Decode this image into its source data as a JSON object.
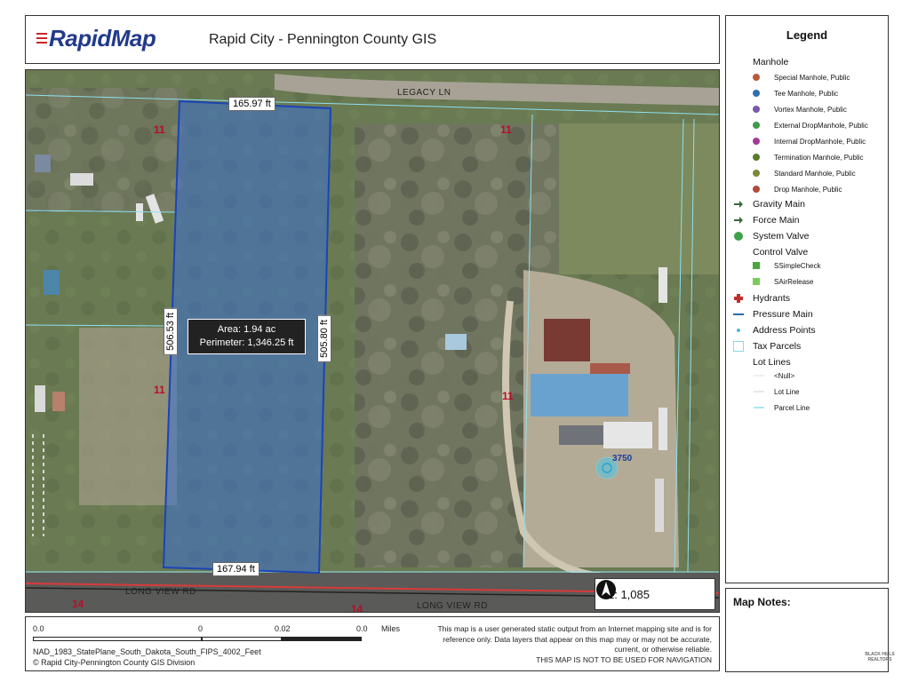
{
  "header": {
    "logo_text": "RapidMap",
    "title": "Rapid City - Pennington County GIS"
  },
  "map": {
    "roads": {
      "legacy_ln": "LEGACY LN",
      "long_view_rd_1": "LONG VIEW RD",
      "long_view_rd_2": "LONG VIEW RD"
    },
    "parcel_numbers": [
      "11",
      "11",
      "11",
      "11",
      "14",
      "14"
    ],
    "address_number": "3750",
    "dimensions": {
      "top": "165.97 ft",
      "bottom": "167.94 ft",
      "left": "506.53 ft",
      "right": "505.80 ft"
    },
    "measurement": {
      "area": "Area: 1.94 ac",
      "perimeter": "Perimeter: 1,346.25 ft"
    },
    "scale_ratio": "1: 1,085",
    "colors": {
      "parcel_line": "#8ee0f0",
      "selection_fill": "#3a6fd1",
      "selection_outline": "#1a44b8",
      "parcel_number": "#b4102a",
      "road_red": "#d93a3a"
    }
  },
  "footer": {
    "scale_labels": [
      "0.0",
      "0",
      "0.02",
      "0.0",
      "Miles"
    ],
    "projection": "NAD_1983_StatePlane_South_Dakota_South_FIPS_4002_Feet",
    "credit": "© Rapid City-Pennington County GIS Division",
    "disclaimer_1": "This map is a user generated static output from an Internet mapping site and is for",
    "disclaimer_2": "reference only. Data layers that appear on this map may or may not be accurate,",
    "disclaimer_3": "current, or otherwise reliable.",
    "disclaimer_4": "THIS MAP IS NOT TO BE USED FOR NAVIGATION"
  },
  "legend": {
    "title": "Legend",
    "manhole_heading": "Manhole",
    "manholes": [
      {
        "label": "Special Manhole, Public",
        "color": "#b85a3a"
      },
      {
        "label": "Tee Manhole, Public",
        "color": "#2f6fb0"
      },
      {
        "label": "Vortex Manhole, Public",
        "color": "#7a5aa8"
      },
      {
        "label": "External DropManhole, Public",
        "color": "#3f9a4a"
      },
      {
        "label": "Internal DropManhole, Public",
        "color": "#a23a9a"
      },
      {
        "label": "Termination Manhole, Public",
        "color": "#5a7a2a"
      },
      {
        "label": "Standard Manhole, Public",
        "color": "#7a8a3a"
      },
      {
        "label": "Drop Manhole, Public",
        "color": "#b04a3a"
      }
    ],
    "gravity_main": "Gravity Main",
    "force_main": "Force Main",
    "system_valve": "System Valve",
    "control_valve": "Control Valve",
    "control_valves": [
      {
        "label": "SSimpleCheck",
        "color": "#4aa83a"
      },
      {
        "label": "SAirRelease",
        "color": "#7acc5a"
      }
    ],
    "hydrants": "Hydrants",
    "pressure_main": "Pressure Main",
    "address_points": "Address Points",
    "tax_parcels": "Tax Parcels",
    "lot_lines": "Lot Lines",
    "lot_line_items": [
      "<Null>",
      "Lot Line",
      "Parcel Line"
    ]
  },
  "notes": {
    "title": "Map Notes:"
  },
  "badge": {
    "line1": "BLACK HILLS",
    "line2": "REALTORS"
  }
}
